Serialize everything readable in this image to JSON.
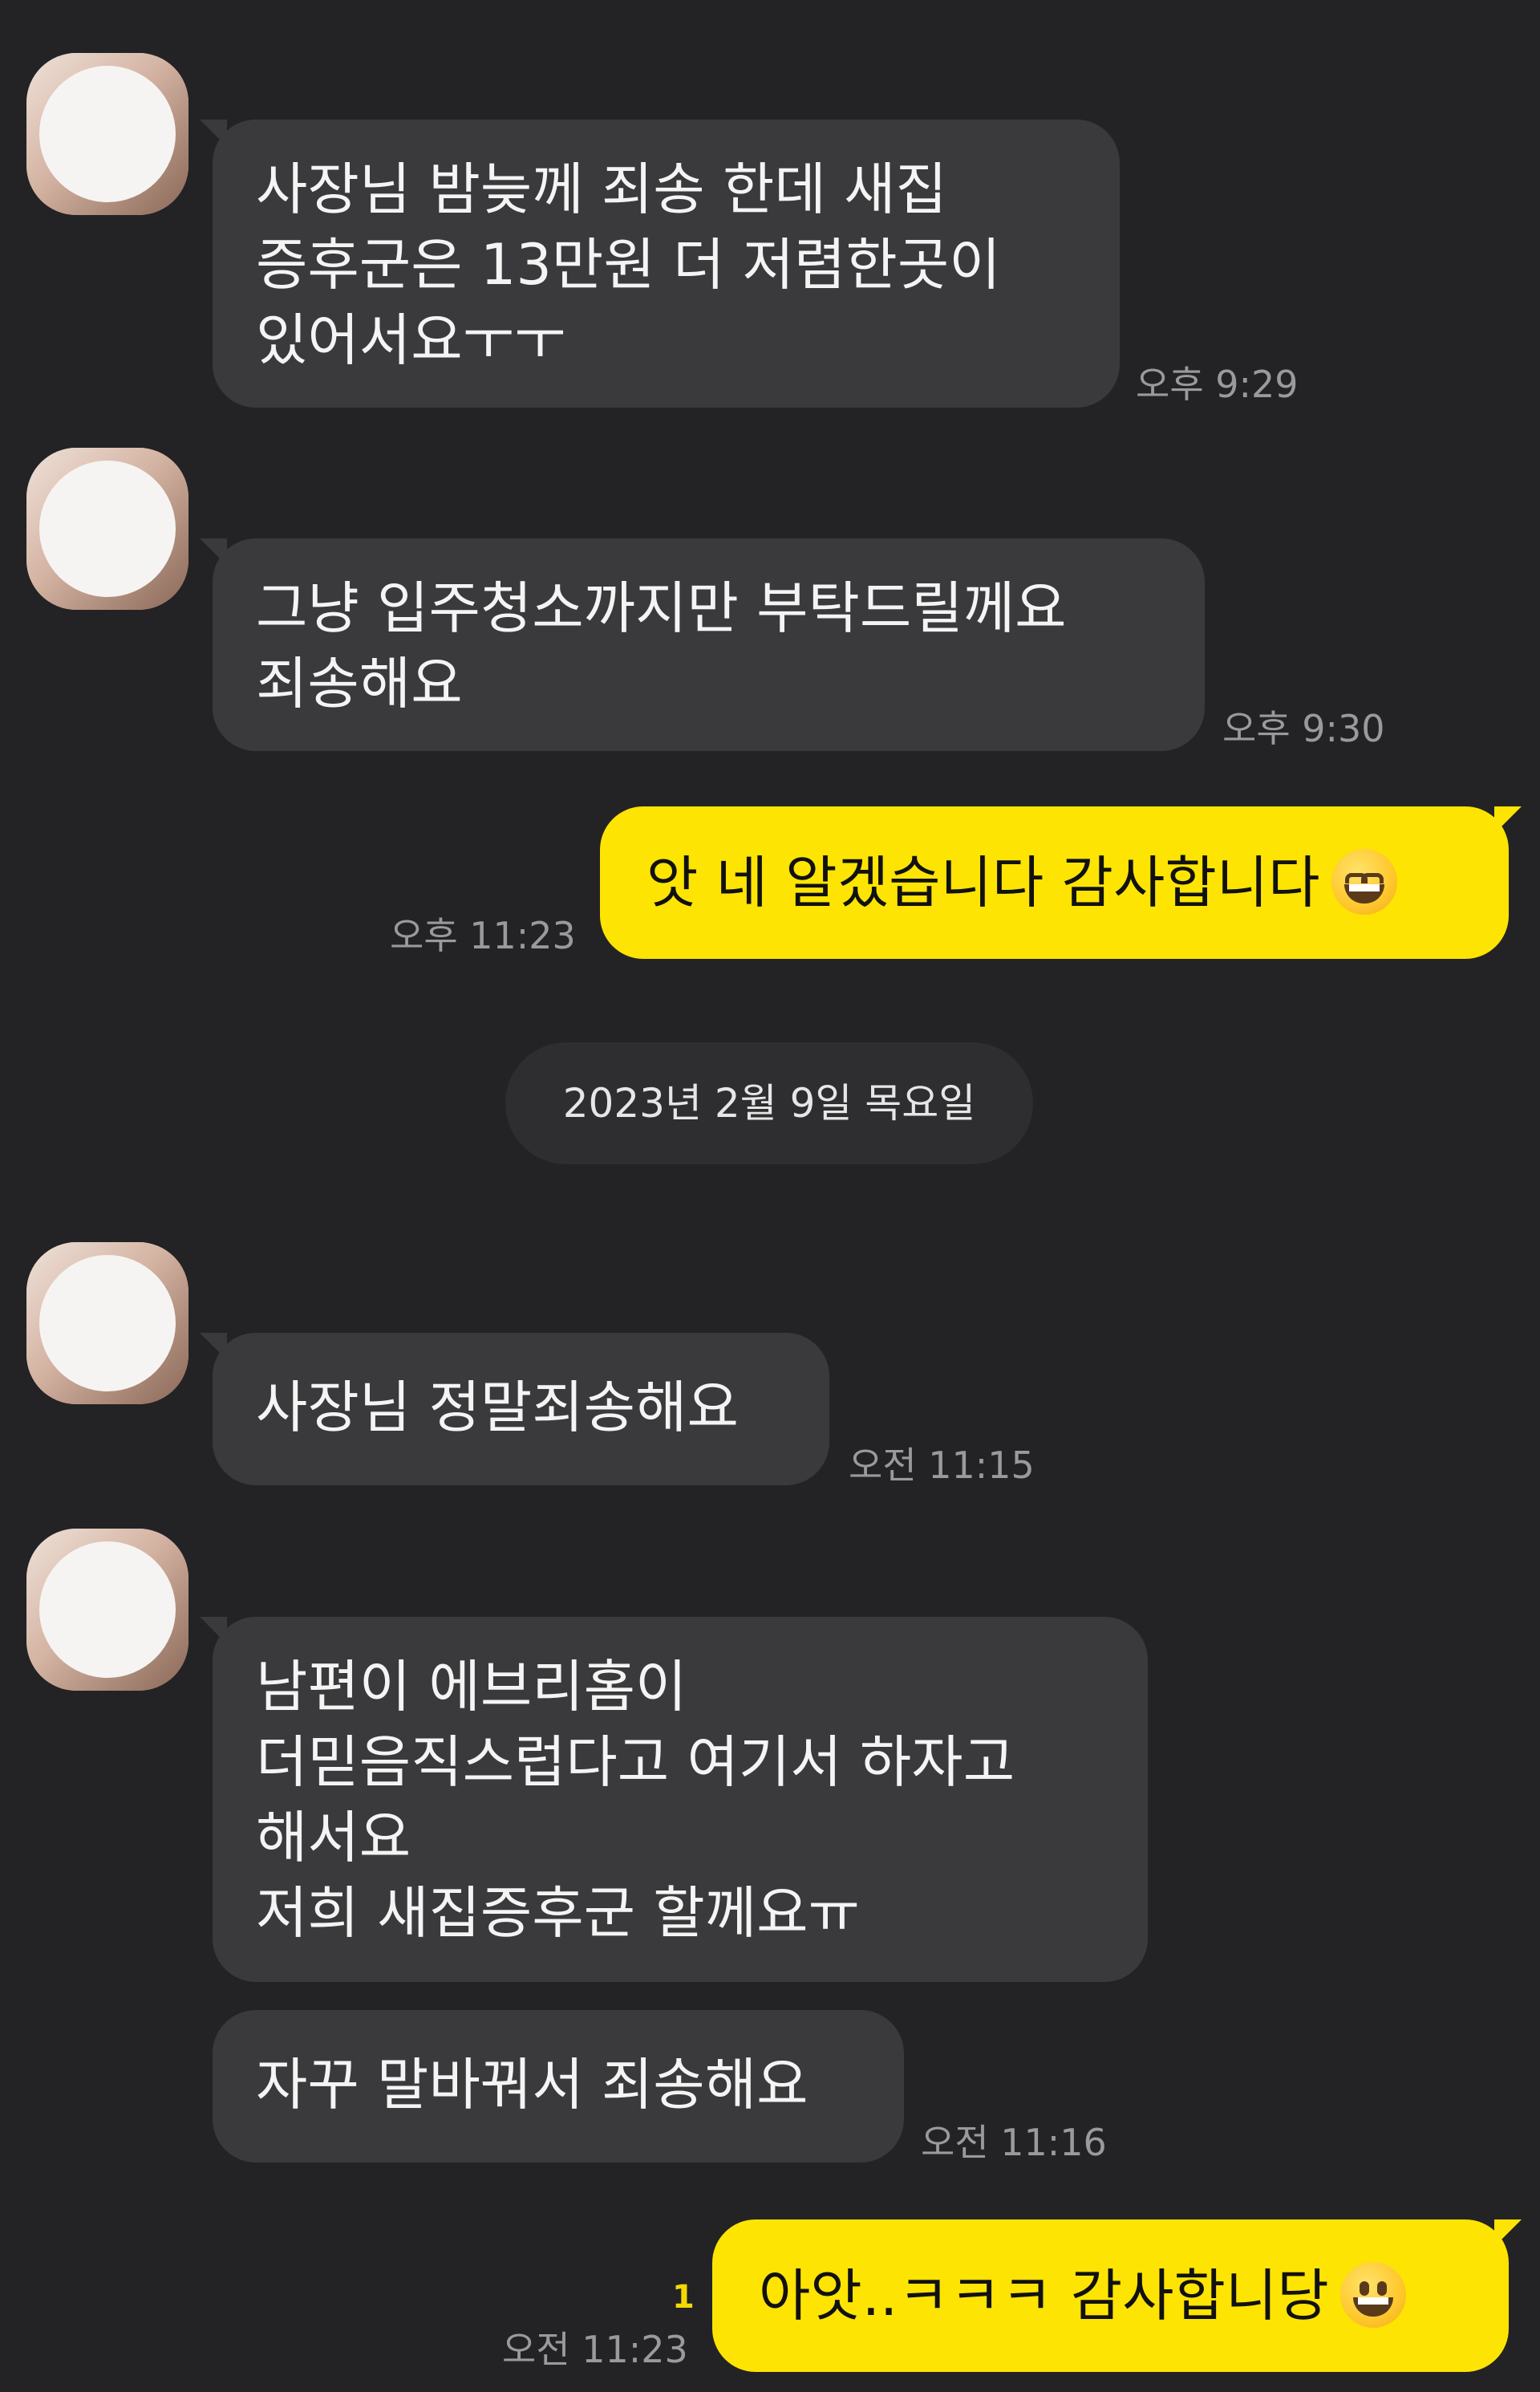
{
  "colors": {
    "background": "#232325",
    "incoming_bubble": "#3a3a3c",
    "outgoing_bubble": "#fde403",
    "timestamp": "#9a9a9d",
    "unread_count": "#f3d900"
  },
  "messages": [
    {
      "sender": "other",
      "lines": [
        "사장님 밤늦께 죄송 한데 새집",
        "증후군은 13만원 더 저렴한곳이",
        "있어서요ㅜㅜ"
      ],
      "time": "오후 9:29"
    },
    {
      "sender": "other",
      "lines": [
        "그냥 입주청소까지만 부탁드릴께요",
        "죄송해요"
      ],
      "time": "오후 9:30"
    },
    {
      "sender": "me",
      "text": "앗 네 알겠습니다 감사합니다",
      "emoji": "grinning-squinting-face",
      "time": "오후 11:23"
    },
    {
      "sender": "other",
      "text": "사장님 정말죄송해요",
      "time": "오전 11:15"
    },
    {
      "sender": "other",
      "lines": [
        "남편이 에브리홈이",
        "더믿음직스럽다고 여기서 하자고",
        "해서요",
        "저희 새집증후군 할께요ㅠ"
      ]
    },
    {
      "sender": "other",
      "text": "자꾸 말바꿔서 죄송해요",
      "time": "오전 11:16"
    },
    {
      "sender": "me",
      "text": "아앗..ㅋㅋㅋ 감사합니당",
      "emoji": "grinning-face",
      "time": "오전 11:23",
      "unread": "1"
    }
  ],
  "date_divider": "2023년 2월 9일 목요일"
}
